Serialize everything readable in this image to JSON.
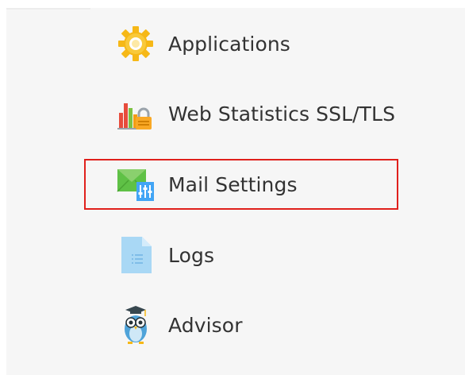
{
  "menu": {
    "items": [
      {
        "label": "Applications",
        "icon": "gear-icon"
      },
      {
        "label": "Web Statistics SSL/TLS",
        "icon": "stats-lock-icon"
      },
      {
        "label": "Mail Settings",
        "icon": "mail-settings-icon"
      },
      {
        "label": "Logs",
        "icon": "document-icon"
      },
      {
        "label": "Advisor",
        "icon": "owl-icon"
      }
    ],
    "highlighted_item": "Mail Settings"
  },
  "colors": {
    "highlight_border": "#e0201c",
    "panel_background": "#f6f6f6",
    "text": "#333333",
    "gear": "#f6b817",
    "mail": "#5fc146",
    "document": "#a9d8f5"
  }
}
